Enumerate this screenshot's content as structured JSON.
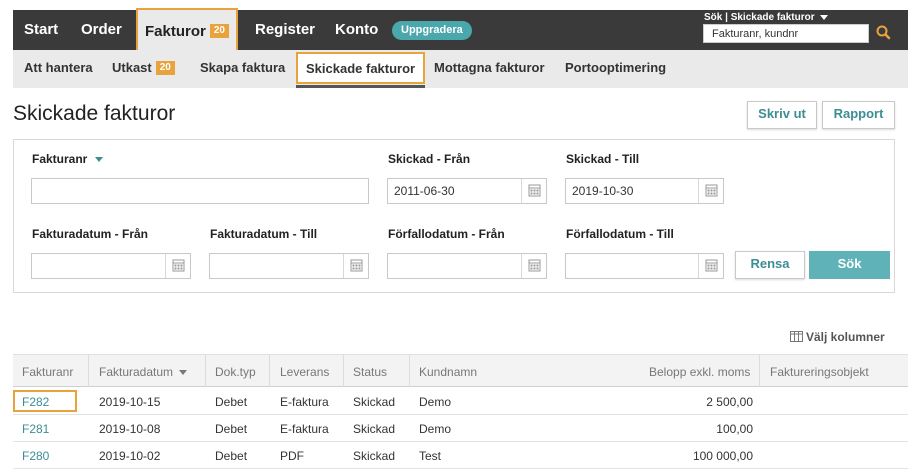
{
  "topnav": {
    "items": [
      {
        "label": "Start"
      },
      {
        "label": "Order"
      },
      {
        "label": "Fakturor",
        "badge": "20"
      },
      {
        "label": "Register"
      },
      {
        "label": "Konto"
      }
    ],
    "upgrade_label": "Uppgradera",
    "search_scope": "Sök | Skickade fakturor",
    "search_value": "Fakturanr, kundnr",
    "search_icon": "search-icon"
  },
  "subnav": {
    "items": [
      {
        "label": "Att hantera"
      },
      {
        "label": "Utkast",
        "badge": "20"
      },
      {
        "label": "Skapa faktura"
      },
      {
        "label": "Skickade fakturor"
      },
      {
        "label": "Mottagna fakturor"
      },
      {
        "label": "Portooptimering"
      }
    ]
  },
  "page": {
    "title": "Skickade fakturor",
    "print_label": "Skriv ut",
    "report_label": "Rapport"
  },
  "filters": {
    "fakturanr_label": "Fakturanr",
    "fakturanr_value": "",
    "skickad_fran_label": "Skickad - Från",
    "skickad_fran_value": "2011-06-30",
    "skickad_till_label": "Skickad - Till",
    "skickad_till_value": "2019-10-30",
    "fakturadatum_fran_label": "Fakturadatum - Från",
    "fakturadatum_till_label": "Fakturadatum - Till",
    "forfallodatum_fran_label": "Förfallodatum - Från",
    "forfallodatum_till_label": "Förfallodatum - Till",
    "clear_label": "Rensa",
    "search_label": "Sök"
  },
  "table": {
    "choose_columns_label": "Välj kolumner",
    "headers": {
      "fakturanr": "Fakturanr",
      "fakturadatum": "Fakturadatum",
      "doktyp": "Dok.typ",
      "leverans": "Leverans",
      "status": "Status",
      "kundnamn": "Kundnamn",
      "belopp": "Belopp exkl. moms",
      "objekt": "Faktureringsobjekt"
    },
    "rows": [
      {
        "fakturanr": "F282",
        "fakturadatum": "2019-10-15",
        "doktyp": "Debet",
        "leverans": "E-faktura",
        "status": "Skickad",
        "kundnamn": "Demo",
        "belopp": "2 500,00",
        "objekt": ""
      },
      {
        "fakturanr": "F281",
        "fakturadatum": "2019-10-08",
        "doktyp": "Debet",
        "leverans": "E-faktura",
        "status": "Skickad",
        "kundnamn": "Demo",
        "belopp": "100,00",
        "objekt": ""
      },
      {
        "fakturanr": "F280",
        "fakturadatum": "2019-10-02",
        "doktyp": "Debet",
        "leverans": "PDF",
        "status": "Skickad",
        "kundnamn": "Test",
        "belopp": "100 000,00",
        "objekt": ""
      }
    ]
  },
  "colors": {
    "accent": "#3c8d94",
    "highlight": "#e8a33d",
    "topbar": "#3a3a3a"
  }
}
